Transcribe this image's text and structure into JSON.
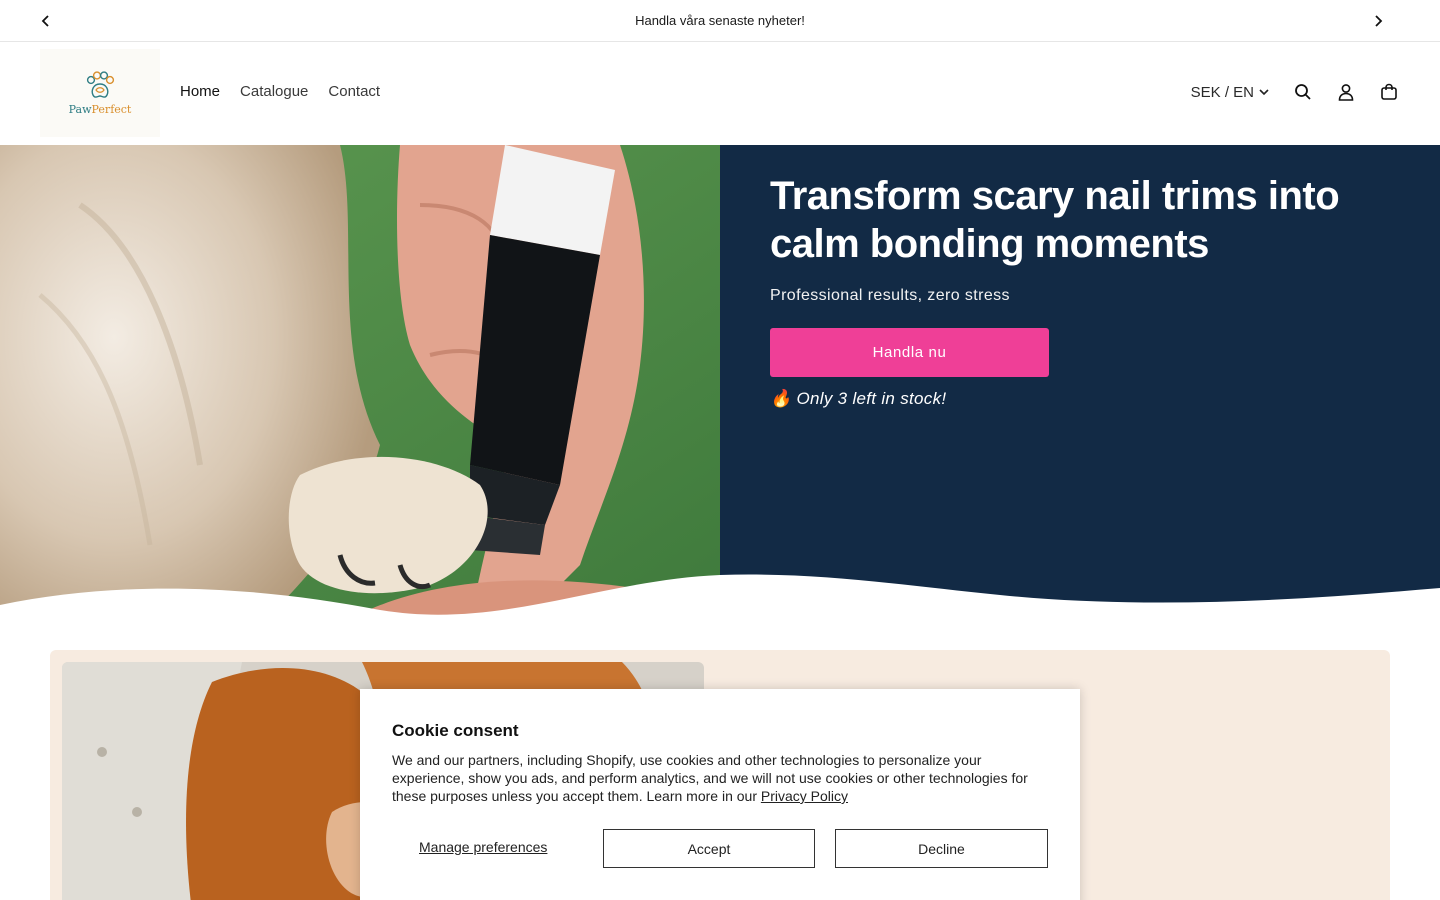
{
  "announcement": {
    "text": "Handla våra senaste nyheter!"
  },
  "header": {
    "logo": {
      "part1": "Paw",
      "part2": "Perfect"
    },
    "nav": [
      {
        "label": "Home"
      },
      {
        "label": "Catalogue"
      },
      {
        "label": "Contact"
      }
    ],
    "currency": "SEK / EN"
  },
  "hero": {
    "title": "Transform scary nail trims into calm bonding moments",
    "subtitle": "Professional results, zero stress",
    "cta": "Handla nu",
    "stock": "🔥 Only 3 left in stock!"
  },
  "cookie": {
    "title": "Cookie consent",
    "body": "We and our partners, including Shopify, use cookies and other technologies to personalize your experience, show you ads, and perform analytics, and we will not use cookies or other technologies for these purposes unless you accept them. Learn more in our ",
    "privacy_link": "Privacy Policy",
    "manage": "Manage preferences",
    "accept": "Accept",
    "decline": "Decline"
  },
  "colors": {
    "hero_bg": "#122a45",
    "cta": "#ef3f97",
    "feature_bg": "#f7ebe0"
  }
}
